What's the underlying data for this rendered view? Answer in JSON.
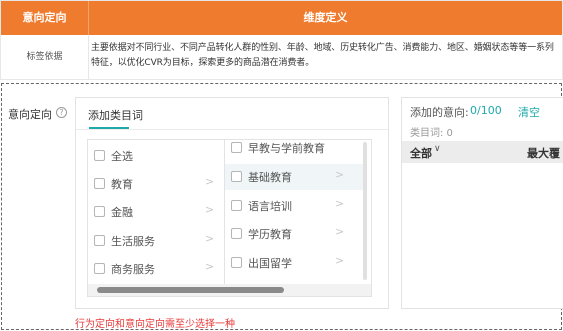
{
  "definition_table": {
    "header_col1": "意向定向",
    "header_col2": "维度定义",
    "row_label": "标签依据",
    "row_text": "主要依据对不同行业、不同产品转化人群的性别、年龄、地域、历史转化广告、消费能力、地区、婚姻状态等等一系列特征，以优化CVR为目标，探索更多的商品潜在消费者。"
  },
  "intent": {
    "label": "意向定向",
    "help_icon": "question-circle-icon"
  },
  "selector": {
    "tab_label": "添加类目词",
    "column1": [
      {
        "label": "全选",
        "has_chevron": false
      },
      {
        "label": "教育",
        "has_chevron": true
      },
      {
        "label": "金融",
        "has_chevron": true
      },
      {
        "label": "生活服务",
        "has_chevron": true
      },
      {
        "label": "商务服务",
        "has_chevron": true
      }
    ],
    "column2": [
      {
        "label": "早教与学前教育",
        "has_chevron": false
      },
      {
        "label": "基础教育",
        "has_chevron": true
      },
      {
        "label": "语言培训",
        "has_chevron": true
      },
      {
        "label": "学历教育",
        "has_chevron": true
      },
      {
        "label": "出国留学",
        "has_chevron": true
      }
    ],
    "chevron_glyph": ">"
  },
  "selected_panel": {
    "added_label": "添加的意向:",
    "count": "0/100",
    "clear_label": "清空",
    "category_count": "类目词: 0",
    "col_all": "全部",
    "col_max": "最大覆"
  },
  "validation": {
    "error_text": "行为定向和意向定向需至少选择一种"
  },
  "colors": {
    "header_bg": "#ee7b2e",
    "accent": "#1fa9a9",
    "error": "#e83a3a"
  }
}
